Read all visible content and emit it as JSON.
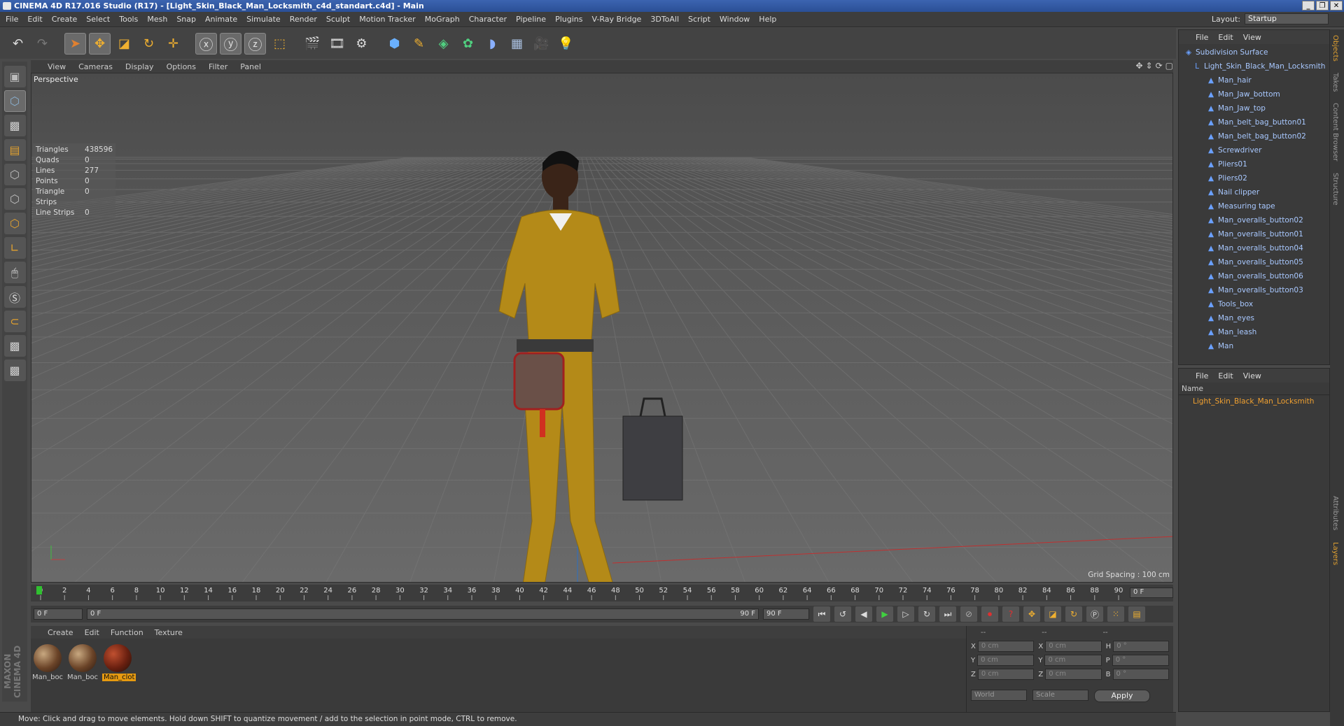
{
  "window": {
    "title": "CINEMA 4D R17.016 Studio (R17) - [Light_Skin_Black_Man_Locksmith_c4d_standart.c4d] - Main",
    "buttons": [
      "_",
      "❐",
      "✕"
    ]
  },
  "menu": [
    "File",
    "Edit",
    "Create",
    "Select",
    "Tools",
    "Mesh",
    "Snap",
    "Animate",
    "Simulate",
    "Render",
    "Sculpt",
    "Motion Tracker",
    "MoGraph",
    "Character",
    "Pipeline",
    "Plugins",
    "V-Ray Bridge",
    "3DToAll",
    "Script",
    "Window",
    "Help"
  ],
  "layout": {
    "label": "Layout:",
    "value": "Startup"
  },
  "viewport": {
    "menu": [
      "View",
      "Cameras",
      "Display",
      "Options",
      "Filter",
      "Panel"
    ],
    "label": "Perspective",
    "grid_spacing": "Grid Spacing : 100 cm",
    "stats": [
      {
        "k": "Triangles",
        "v": "438596"
      },
      {
        "k": "Quads",
        "v": "0"
      },
      {
        "k": "Lines",
        "v": "277"
      },
      {
        "k": "Points",
        "v": "0"
      },
      {
        "k": "Triangle Strips",
        "v": "0"
      },
      {
        "k": "Line Strips",
        "v": "0"
      }
    ]
  },
  "timeline": {
    "ticks": [
      "0",
      "2",
      "4",
      "6",
      "8",
      "10",
      "12",
      "14",
      "16",
      "18",
      "20",
      "22",
      "24",
      "26",
      "28",
      "30",
      "32",
      "34",
      "36",
      "38",
      "40",
      "42",
      "44",
      "46",
      "48",
      "50",
      "52",
      "54",
      "56",
      "58",
      "60",
      "62",
      "64",
      "66",
      "68",
      "70",
      "72",
      "74",
      "76",
      "78",
      "80",
      "82",
      "84",
      "86",
      "88",
      "90"
    ],
    "frame": "0 F"
  },
  "controls": {
    "start": "0 F",
    "range_start": "0 F",
    "range_end": "90 F",
    "end": "90 F"
  },
  "materials": {
    "menu": [
      "Create",
      "Edit",
      "Function",
      "Texture"
    ],
    "items": [
      "Man_boc",
      "Man_boc",
      "Man_clot"
    ]
  },
  "coords": {
    "header": [
      "--",
      "--",
      "--"
    ],
    "rows": [
      [
        "X",
        "0 cm",
        "X",
        "0 cm",
        "H",
        "0 °"
      ],
      [
        "Y",
        "0 cm",
        "Y",
        "0 cm",
        "P",
        "0 °"
      ],
      [
        "Z",
        "0 cm",
        "Z",
        "0 cm",
        "B",
        "0 °"
      ]
    ],
    "world": "World",
    "scale": "Scale",
    "apply": "Apply"
  },
  "status": "Move: Click and drag to move elements. Hold down SHIFT to quantize movement / add to the selection in point mode, CTRL to remove.",
  "objects": {
    "menu": [
      "File",
      "Edit",
      "View"
    ],
    "items": [
      {
        "name": "Subdivision Surface",
        "level": 0
      },
      {
        "name": "Light_Skin_Black_Man_Locksmith",
        "level": 1
      },
      {
        "name": "Man_hair",
        "level": 2
      },
      {
        "name": "Man_Jaw_bottom",
        "level": 2
      },
      {
        "name": "Man_Jaw_top",
        "level": 2
      },
      {
        "name": "Man_belt_bag_button01",
        "level": 2
      },
      {
        "name": "Man_belt_bag_button02",
        "level": 2
      },
      {
        "name": "Screwdriver",
        "level": 2
      },
      {
        "name": "Pliers01",
        "level": 2
      },
      {
        "name": "Pliers02",
        "level": 2
      },
      {
        "name": "Nail clipper",
        "level": 2
      },
      {
        "name": "Measuring tape",
        "level": 2
      },
      {
        "name": "Man_overalls_button02",
        "level": 2
      },
      {
        "name": "Man_overalls_button01",
        "level": 2
      },
      {
        "name": "Man_overalls_button04",
        "level": 2
      },
      {
        "name": "Man_overalls_button05",
        "level": 2
      },
      {
        "name": "Man_overalls_button06",
        "level": 2
      },
      {
        "name": "Man_overalls_button03",
        "level": 2
      },
      {
        "name": "Tools_box",
        "level": 2
      },
      {
        "name": "Man_eyes",
        "level": 2
      },
      {
        "name": "Man_leash",
        "level": 2
      },
      {
        "name": "Man",
        "level": 2
      }
    ]
  },
  "layers": {
    "menu": [
      "File",
      "Edit",
      "View"
    ],
    "header": "Name",
    "item": "Light_Skin_Black_Man_Locksmith"
  },
  "sidetabs": [
    "Objects",
    "Takes",
    "Content Browser",
    "Structure",
    "Attributes",
    "Layers"
  ],
  "logo": "MAXON CINEMA 4D"
}
